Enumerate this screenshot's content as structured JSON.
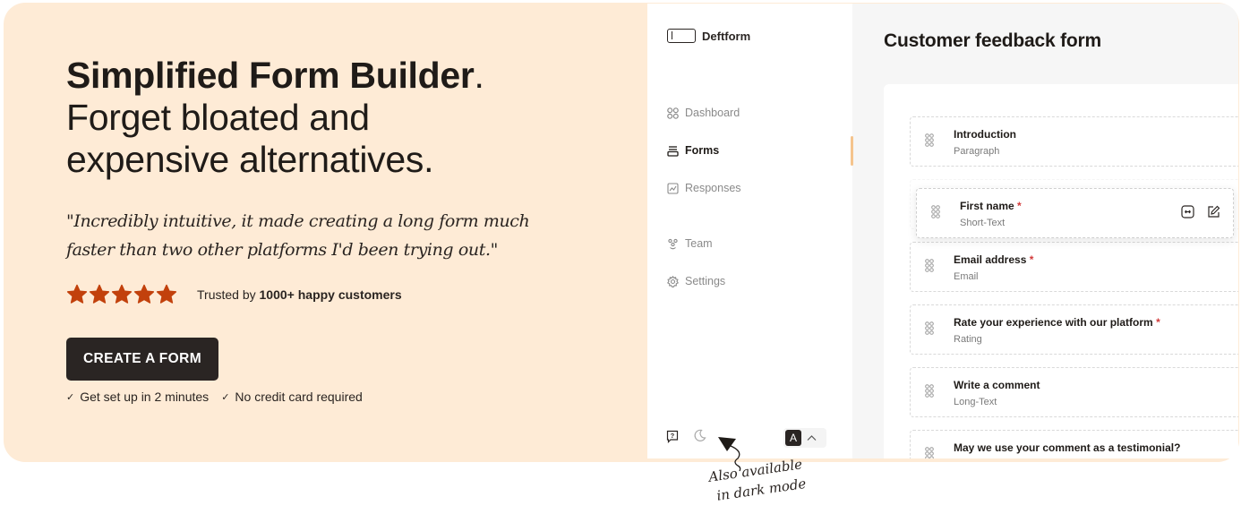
{
  "hero": {
    "headline_bold": "Simplified Form Builder",
    "headline_period": ".",
    "headline_line2": "Forget bloated and",
    "headline_line3": "expensive alternatives.",
    "quote_line1": "\"Incredibly intuitive, it made creating a long form much",
    "quote_line2": "faster than two other platforms I'd been trying out.\"",
    "rating": {
      "stars": 5,
      "max": 5,
      "color": "#c2410c"
    },
    "trusted_prefix": "Trusted by",
    "trusted_bold": "1000+ happy customers",
    "cta_label": "CREATE A FORM",
    "perks": [
      "Get set up in 2 minutes",
      "No credit card required"
    ],
    "check_icon": "✓",
    "background": "#feebd6"
  },
  "app": {
    "brand": "Deftform",
    "nav": [
      {
        "label": "Dashboard",
        "icon": "dashboard-icon",
        "active": false
      },
      {
        "label": "Forms",
        "icon": "forms-icon",
        "active": true
      },
      {
        "label": "Responses",
        "icon": "responses-icon",
        "active": false
      },
      {
        "label": "Team",
        "icon": "team-icon",
        "active": false
      },
      {
        "label": "Settings",
        "icon": "gear-icon",
        "active": false
      }
    ],
    "language_badge": "A",
    "page_title": "Customer feedback form",
    "fields": [
      {
        "label": "Introduction",
        "type": "Paragraph",
        "required": false
      },
      {
        "label": "First name",
        "type": "Short-Text",
        "required": true,
        "dragging": true
      },
      {
        "label": "Email address",
        "type": "Email",
        "required": true
      },
      {
        "label": "Rate your experience with our platform",
        "type": "Rating",
        "required": true
      },
      {
        "label": "Write a comment",
        "type": "Long-Text",
        "required": false
      },
      {
        "label": "May we use your comment as a testimonial?",
        "type": "",
        "required": false
      }
    ],
    "required_mark": "*",
    "accent": "#f5c48d"
  },
  "annotation": {
    "line1": "Also available",
    "line2": "in dark mode"
  }
}
